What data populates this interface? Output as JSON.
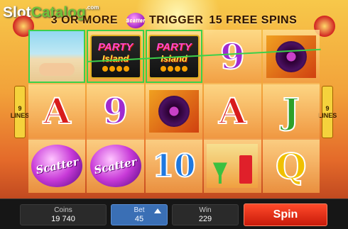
{
  "logo": {
    "text_main": "Slot",
    "text_accent": "Catalog",
    "suffix": ".com"
  },
  "banner": {
    "lead": "3 OR MORE",
    "scatter_label": "Scatter",
    "mid": "TRIGGER",
    "free": "15 FREE SPINS"
  },
  "lines_left": {
    "num": "9",
    "word": "LINES"
  },
  "lines_right": {
    "num": "9",
    "word": "LINES"
  },
  "reels": [
    [
      "beach",
      "A",
      "scatter"
    ],
    [
      "party",
      "9",
      "scatter"
    ],
    [
      "party",
      "vinyl",
      "10"
    ],
    [
      "9",
      "A",
      "cocktail"
    ],
    [
      "vinyl",
      "J",
      "Q"
    ]
  ],
  "symbols": {
    "party_line1": "PARTY",
    "party_line2": "Island",
    "scatter_text": "Scatter"
  },
  "controls": {
    "coins_label": "Coins",
    "coins_value": "19 740",
    "bet_label": "Bet",
    "bet_value": "45",
    "win_label": "Win",
    "win_value": "229",
    "spin_label": "Spin"
  },
  "colors": {
    "win_outline": "#3cd04a",
    "spin_button": "#e8301a",
    "bet_panel": "#3a6fb5"
  }
}
